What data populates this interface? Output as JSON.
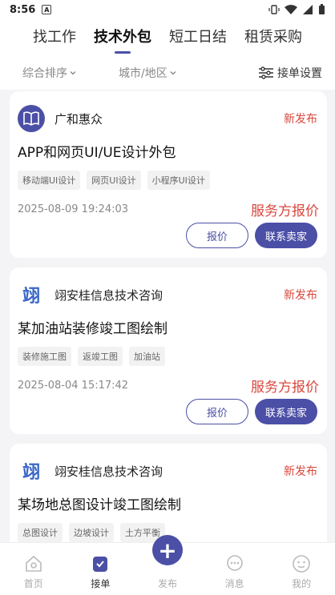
{
  "status_bar": {
    "time": "8:56",
    "a_icon": "A"
  },
  "tabs": [
    {
      "label": "找工作"
    },
    {
      "label": "技术外包"
    },
    {
      "label": "短工日结"
    },
    {
      "label": "租赁采购"
    }
  ],
  "filters": {
    "sort": "综合排序",
    "city": "城市/地区",
    "settings": "接单设置"
  },
  "cards": [
    {
      "company": "广和惠众",
      "status": "新发布",
      "title": "APP和网页UI/UE设计外包",
      "tags": [
        "移动端UI设计",
        "网页UI设计",
        "小程序UI设计"
      ],
      "time": "2025-08-09 19:24:03",
      "quote_type": "服务方报价",
      "btn_quote": "报价",
      "btn_contact": "联系卖家"
    },
    {
      "company": "翊安桂信息技术咨询",
      "logo_text": "翊",
      "status": "新发布",
      "title": "某加油站装修竣工图绘制",
      "tags": [
        "装修施工图",
        "返竣工图",
        "加油站"
      ],
      "time": "2025-08-04 15:17:42",
      "quote_type": "服务方报价",
      "btn_quote": "报价",
      "btn_contact": "联系卖家"
    },
    {
      "company": "翊安桂信息技术咨询",
      "logo_text": "翊",
      "status": "新发布",
      "title": "某场地总图设计竣工图绘制",
      "tags": [
        "总图设计",
        "边坡设计",
        "土方平衡"
      ]
    }
  ],
  "nav": [
    {
      "label": "首页",
      "icon": "home-icon"
    },
    {
      "label": "接单",
      "icon": "order-icon"
    },
    {
      "label": "发布",
      "icon": "plus-icon"
    },
    {
      "label": "消息",
      "icon": "message-icon"
    },
    {
      "label": "我的",
      "icon": "profile-icon"
    }
  ],
  "colors": {
    "accent": "#4b4fa6",
    "status_red": "#d9473d"
  }
}
